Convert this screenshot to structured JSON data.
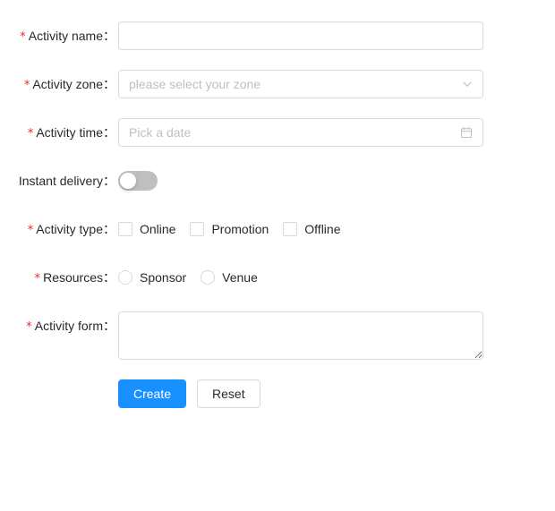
{
  "form": {
    "rows": [
      {
        "key": "activity_name",
        "required": true,
        "label": "Activity name",
        "colon": "：",
        "control": "input",
        "value": "",
        "placeholder": ""
      },
      {
        "key": "activity_zone",
        "required": true,
        "label": "Activity zone",
        "colon": "：",
        "control": "select",
        "value": "",
        "placeholder": "please select your zone",
        "icon": "chevron-down-icon"
      },
      {
        "key": "activity_time",
        "required": true,
        "label": "Activity time",
        "colon": "：",
        "control": "datepicker",
        "value": "",
        "placeholder": "Pick a date",
        "icon": "calendar-icon"
      },
      {
        "key": "instant_delivery",
        "required": false,
        "label": "Instant delivery",
        "colon": "：",
        "control": "switch",
        "checked": false
      },
      {
        "key": "activity_type",
        "required": true,
        "label": "Activity type",
        "colon": "：",
        "control": "checkbox-group",
        "options": [
          {
            "label": "Online",
            "checked": false
          },
          {
            "label": "Promotion",
            "checked": false
          },
          {
            "label": "Offline",
            "checked": false
          }
        ]
      },
      {
        "key": "resources",
        "required": true,
        "label": "Resources",
        "colon": "：",
        "control": "radio-group",
        "options": [
          {
            "label": "Sponsor",
            "checked": false
          },
          {
            "label": "Venue",
            "checked": false
          }
        ]
      },
      {
        "key": "activity_form",
        "required": true,
        "label": "Activity form",
        "colon": "：",
        "control": "textarea",
        "value": "",
        "placeholder": ""
      }
    ],
    "actions": {
      "submit_label": "Create",
      "reset_label": "Reset"
    }
  },
  "colors": {
    "primary": "#1890ff",
    "required_star": "#f5222d",
    "border": "#d9d9d9",
    "placeholder": "#bfbfbf",
    "switch_off": "#bfbfbf",
    "text": "rgba(0,0,0,0.85)"
  }
}
